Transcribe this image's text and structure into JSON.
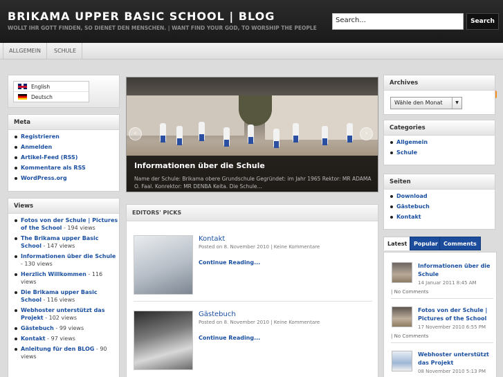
{
  "header": {
    "site_title": "BRIKAMA UPPER BASIC SCHOOL | BLOG",
    "tagline": "WOLLT IHR GOTT FINDEN, SO DIENET DEN MENSCHEN. | WANT FIND YOUR GOD, TO WORSHIP THE PEOPLE",
    "search_placeholder": "Search...",
    "search_button": "Search"
  },
  "nav": {
    "items": [
      {
        "label": "ALLGEMEIN"
      },
      {
        "label": "SCHULE"
      }
    ],
    "rss_icon": "rss-icon"
  },
  "languages": [
    {
      "label": "English",
      "flag": "uk-flag-icon"
    },
    {
      "label": "Deutsch",
      "flag": "de-flag-icon"
    }
  ],
  "meta": {
    "title": "Meta",
    "links": [
      "Registrieren",
      "Anmelden",
      "Artikel-Feed (RSS)",
      "Kommentare als RSS",
      "WordPress.org"
    ]
  },
  "views": {
    "title": "Views",
    "items": [
      {
        "title": "Fotos von der Schule | Pictures of the School",
        "count": " - 194 views"
      },
      {
        "title": "The Brikama upper Basic School",
        "count": " - 147 views"
      },
      {
        "title": "Informationen über die Schule",
        "count": " - 130 views"
      },
      {
        "title": "Herzlich Willkommen",
        "count": " - 116 views"
      },
      {
        "title": "Die Brikama upper Basic School",
        "count": " - 116 views"
      },
      {
        "title": "Webhoster unterstützt das Projekt",
        "count": " - 102 views"
      },
      {
        "title": "Gästebuch",
        "count": " - 99 views"
      },
      {
        "title": "Kontakt",
        "count": " - 97 views"
      },
      {
        "title": "Anleitung für den BLOG",
        "count": " - 90 views"
      }
    ]
  },
  "slider": {
    "title": "Informationen über die Schule",
    "text": "Name der Schule: Brikama obere Grundschule Gegründet:  im Jahr 1965  Rektor: MR ADAMA O. Faal. Konrektor: MR DENBA Keita. Die Schule…",
    "prev": "‹",
    "next": "›"
  },
  "editors": {
    "title": "EDITORS' PICKS",
    "posts": [
      {
        "title": "Kontakt",
        "meta": "Posted on 8. November 2010  |  Keine Kommentare",
        "more": "Continue Reading..."
      },
      {
        "title": "Gästebuch",
        "meta": "Posted on 8. November 2010  |  Keine Kommentare",
        "more": "Continue Reading..."
      }
    ]
  },
  "archives": {
    "title": "Archives",
    "select_value": "Wähle den Monat"
  },
  "categories": {
    "title": "Categories",
    "items": [
      "Allgemein",
      "Schule"
    ]
  },
  "pages": {
    "title": "Seiten",
    "items": [
      "Download",
      "Gästebuch",
      "Kontakt"
    ]
  },
  "tabs": {
    "latest": "Latest",
    "popular": "Popular",
    "comments": "Comments"
  },
  "latest": [
    {
      "title": "Informationen über die Schule",
      "date": "14 Januar 2011 8:45 AM",
      "comments": "| No Comments"
    },
    {
      "title": "Fotos von der Schule | Pictures of the School",
      "date": "17 November 2010 6:55 PM",
      "comments": "| No Comments"
    },
    {
      "title": "Webhoster unterstützt das Projekt",
      "date": "08 November 2010 5:13 PM",
      "comments": ""
    }
  ],
  "colors": {
    "header_bg": "#222222",
    "link": "#1a4fa0",
    "tab_active": "#1c4c9c"
  }
}
